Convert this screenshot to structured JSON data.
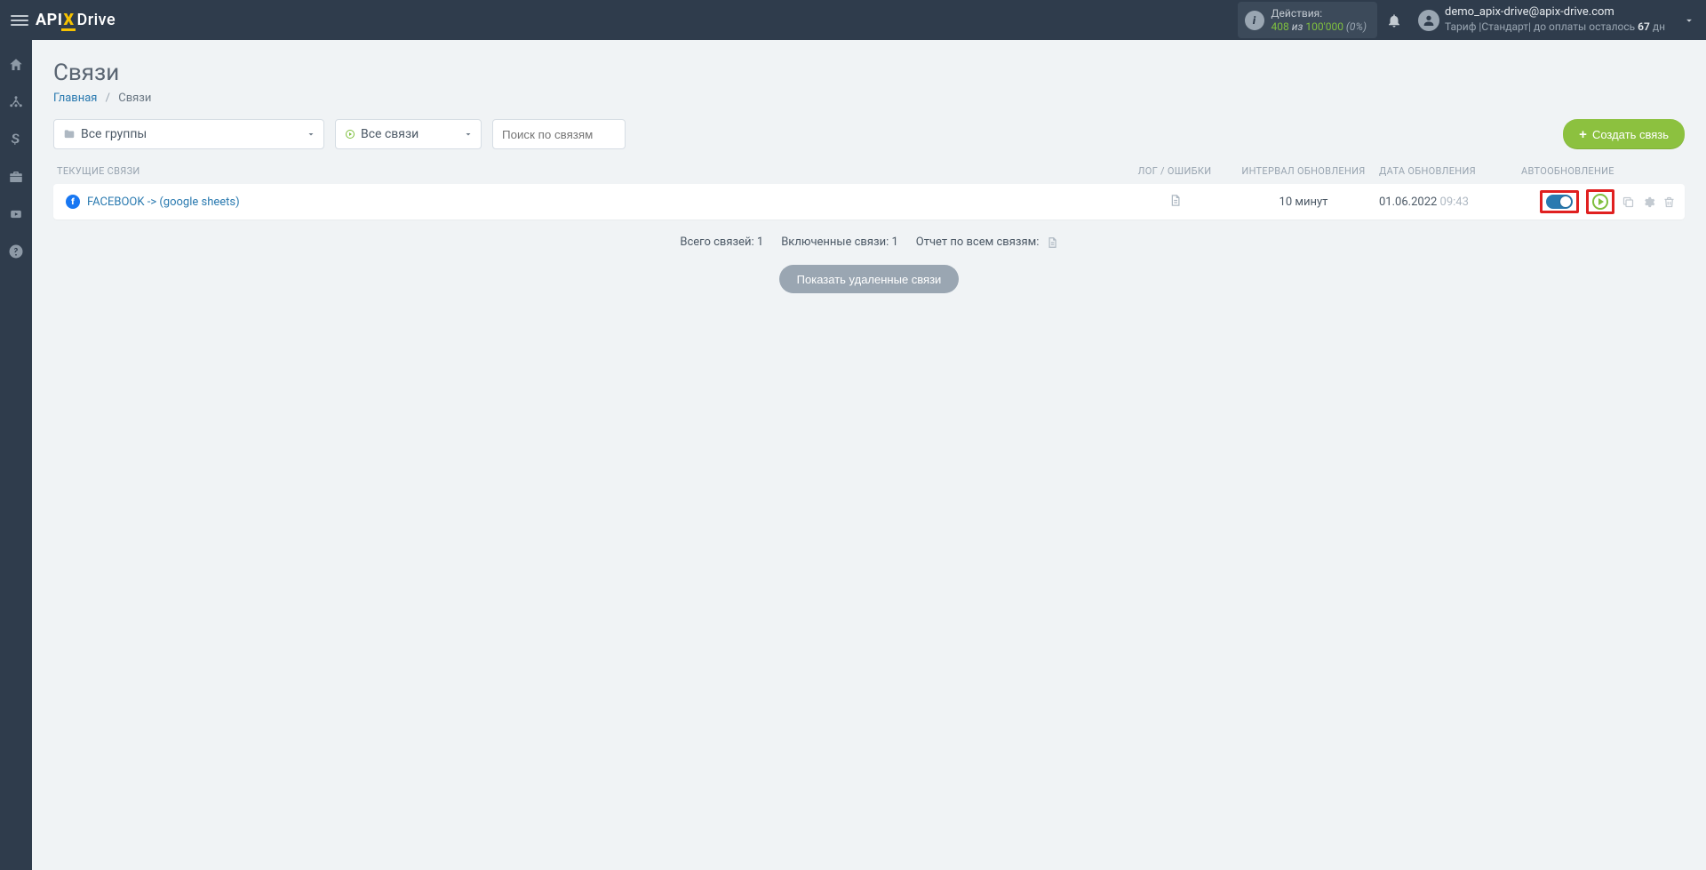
{
  "logo": {
    "part1": "API",
    "part2": "X",
    "part3": "Drive"
  },
  "header": {
    "actions_label": "Действия:",
    "actions_used": "408",
    "actions_of": "из",
    "actions_total": "100'000",
    "actions_pct": "(0%)",
    "email": "demo_apix-drive@apix-drive.com",
    "tariff_prefix": "Тариф |Стандарт| до оплаты осталось ",
    "tariff_days": "67",
    "tariff_suffix": " дн"
  },
  "page": {
    "title": "Связи",
    "bc_home": "Главная",
    "bc_current": "Связи"
  },
  "filters": {
    "group_label": "Все группы",
    "status_label": "Все связи",
    "search_placeholder": "Поиск по связям",
    "create_label": "Создать связь"
  },
  "columns": {
    "c1": "ТЕКУЩИЕ СВЯЗИ",
    "c2": "ЛОГ / ОШИБКИ",
    "c3": "ИНТЕРВАЛ ОБНОВЛЕНИЯ",
    "c4": "ДАТА ОБНОВЛЕНИЯ",
    "c5": "АВТООБНОВЛЕНИЕ"
  },
  "row": {
    "name": "FACEBOOK -> (google sheets)",
    "interval": "10 минут",
    "date": "01.06.2022",
    "time": "09:43"
  },
  "summary": {
    "total": "Всего связей: 1",
    "enabled": "Включенные связи: 1",
    "report": "Отчет по всем связям:"
  },
  "show_deleted": "Показать удаленные связи"
}
